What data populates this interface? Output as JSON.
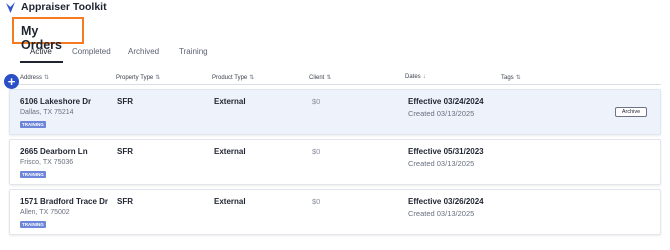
{
  "app": {
    "title": "Appraiser Toolkit"
  },
  "page": {
    "title": "My Orders"
  },
  "tabs": [
    {
      "label": "Active",
      "active": true
    },
    {
      "label": "Completed",
      "active": false
    },
    {
      "label": "Archived",
      "active": false
    },
    {
      "label": "Training",
      "active": false
    }
  ],
  "fab": {
    "label": "+"
  },
  "columns": [
    {
      "label": "Address",
      "sort": "⇅"
    },
    {
      "label": "Property Type",
      "sort": "⇅"
    },
    {
      "label": "Product Type",
      "sort": "⇅"
    },
    {
      "label": "Client",
      "sort": "⇅"
    },
    {
      "label": "Dates",
      "sort": "↓"
    },
    {
      "label": "Tags",
      "sort": "⇅"
    }
  ],
  "orders": [
    {
      "street": "6106 Lakeshore Dr",
      "city": "Dallas, TX 75214",
      "badge": "TRAINING",
      "property_type": "SFR",
      "product_type": "External",
      "client": "$0",
      "effective": "Effective 03/24/2024",
      "created": "Created 03/13/2025",
      "archive_label": "Archive"
    },
    {
      "street": "2665 Dearborn Ln",
      "city": "Frisco, TX 75036",
      "badge": "TRAINING",
      "property_type": "SFR",
      "product_type": "External",
      "client": "$0",
      "effective": "Effective 05/31/2023",
      "created": "Created 03/13/2025"
    },
    {
      "street": "1571 Bradford Trace Dr",
      "city": "Allen, TX 75002",
      "badge": "TRAINING",
      "property_type": "SFR",
      "product_type": "External",
      "client": "$0",
      "effective": "Effective 03/26/2024",
      "created": "Created 03/13/2025"
    }
  ],
  "colors": {
    "accent_blue": "#2b4fc7",
    "badge_blue": "#6d86d9",
    "title_outline": "#f47b20",
    "row_highlight": "#eef2fb"
  }
}
